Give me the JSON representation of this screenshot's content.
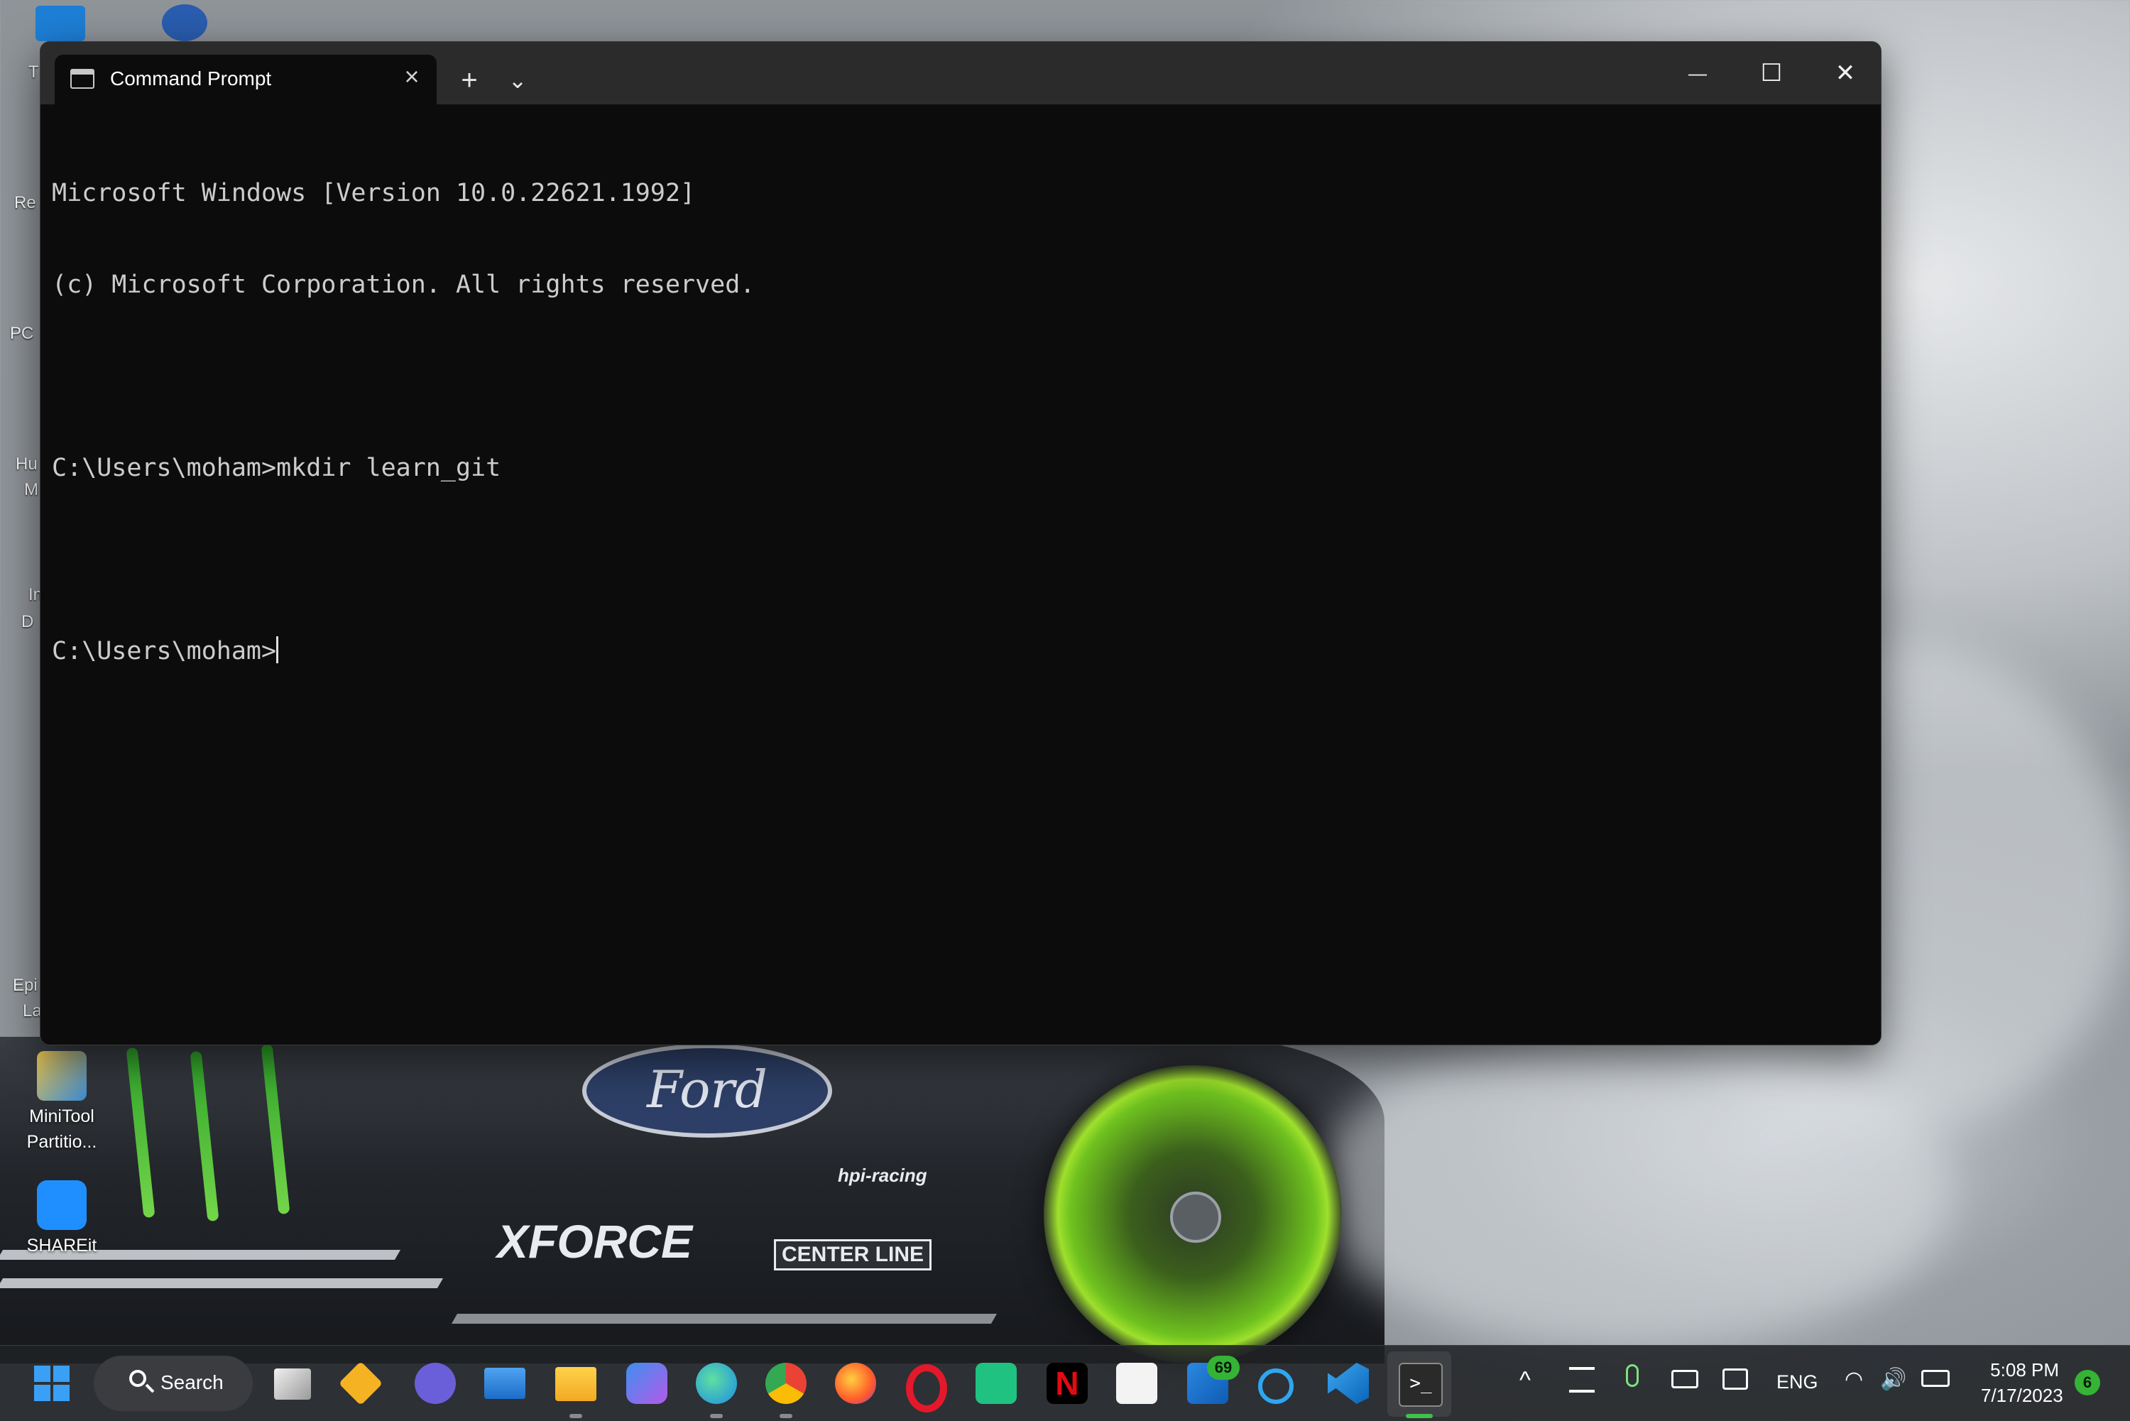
{
  "desktop": {
    "icons": [
      {
        "label_line1": "MiniTool",
        "label_line2": "Partitio...",
        "icon": "minitool-partition-icon"
      },
      {
        "label_line1": "SHAREit",
        "label_line2": "",
        "icon": "shareit-icon"
      }
    ],
    "edge_labels": [
      "T",
      "Re",
      "PC",
      "Hu",
      "M",
      "In",
      "D",
      "Epi",
      "La"
    ],
    "wallpaper_text": {
      "ford": "Ford",
      "xforce": "XFORCE",
      "centerline": "CENTER LINE",
      "hpi": "hpi-racing"
    }
  },
  "window": {
    "tab_title": "Command Prompt",
    "tab_icon": "command-prompt-icon",
    "new_tab": "+",
    "dropdown": "⌄",
    "minimize": "—",
    "maximize": "☐",
    "close": "✕"
  },
  "console": {
    "lines": [
      "Microsoft Windows [Version 10.0.22621.1992]",
      "(c) Microsoft Corporation. All rights reserved.",
      "",
      "C:\\Users\\moham>mkdir learn_git",
      "",
      "C:\\Users\\moham>"
    ]
  },
  "taskbar": {
    "search_label": "Search",
    "apps": [
      "start-icon",
      "task-view-icon",
      "sticky-app-icon",
      "teams-chat-icon",
      "mail-icon",
      "file-explorer-icon",
      "copilot-icon",
      "edge-icon",
      "chrome-icon",
      "firefox-icon",
      "opera-icon",
      "android-app-icon",
      "netflix-icon",
      "store-icon",
      "outlook-icon",
      "cortana-icon",
      "vscode-icon",
      "terminal-icon"
    ],
    "outlook_badge": "69",
    "tray": {
      "language": "ENG",
      "time": "5:08 PM",
      "date": "7/17/2023",
      "notification_count": "6"
    }
  },
  "colors": {
    "terminal_bg": "#0c0c0c",
    "titlebar_bg": "#2b2b2b",
    "console_text": "#cccccc",
    "badge_green": "#35b335"
  }
}
